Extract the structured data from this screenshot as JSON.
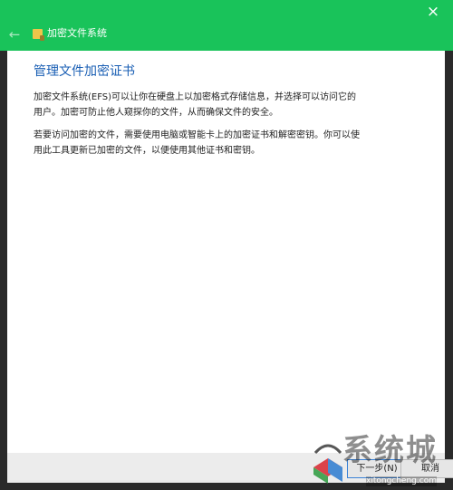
{
  "window": {
    "title": "加密文件系统",
    "close_glyph": "×",
    "back_glyph": "←"
  },
  "content": {
    "heading": "管理文件加密证书",
    "para1": "加密文件系统(EFS)可以让你在硬盘上以加密格式存储信息，并选择可以访问它的用户。加密可防止他人窥探你的文件，从而确保文件的安全。",
    "para2": "若要访问加密的文件，需要使用电脑或智能卡上的加密证书和解密密钥。你可以使用此工具更新已加密的文件，以便使用其他证书和密钥。"
  },
  "footer": {
    "next_label": "下一步(N)",
    "cancel_label": "取消"
  },
  "watermark": {
    "text": "系统城",
    "url": "xitongcheng.com"
  },
  "colors": {
    "titlebar": "#19c35a",
    "heading": "#1a5fb4"
  }
}
